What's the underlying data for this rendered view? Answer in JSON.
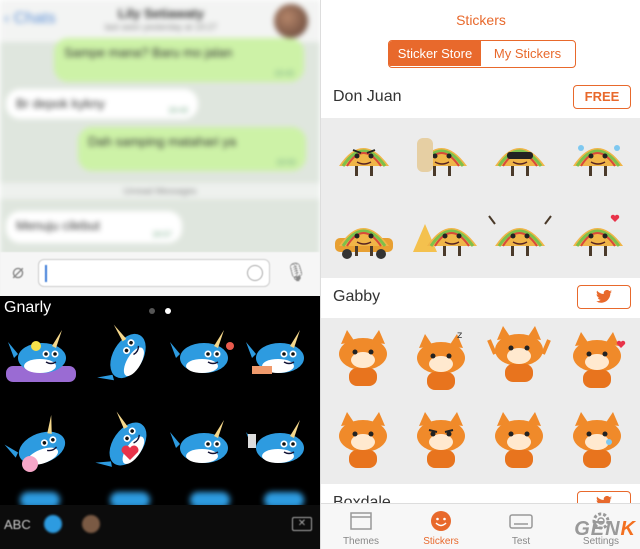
{
  "chat": {
    "back_label": "Chats",
    "name": "Lily Setiawaty",
    "status": "last seen yesterday at 19:27",
    "unread_label": "Unread Messages",
    "messages": [
      {
        "dir": "out",
        "text": "Sampe mana? Baru mo jalan",
        "time": "19:43"
      },
      {
        "dir": "in",
        "text": "Br depok kykny",
        "time": "19:43"
      },
      {
        "dir": "out",
        "text": "Dah samping matahari ya",
        "time": "19:50"
      },
      {
        "dir": "in",
        "text": "Menuju cilebut",
        "time": "19:57"
      }
    ]
  },
  "keyboard": {
    "pack_title": "Gnarly",
    "abc_label": "ABC",
    "delete_icon": "backspace-icon"
  },
  "store": {
    "title": "Stickers",
    "segments": [
      "Sticker Store",
      "My Stickers"
    ],
    "packs": [
      {
        "name": "Don Juan",
        "button": "FREE",
        "theme": "taco"
      },
      {
        "name": "Gabby",
        "button": "",
        "button_icon": "twitter-bird-icon",
        "theme": "cat"
      },
      {
        "name": "Boxdale",
        "button": "",
        "button_icon": "twitter-bird-icon",
        "theme": "none"
      }
    ],
    "tabs": [
      {
        "label": "Themes",
        "icon": "themes-icon"
      },
      {
        "label": "Stickers",
        "icon": "smiley-icon",
        "active": true
      },
      {
        "label": "Test",
        "icon": "keyboard-icon"
      },
      {
        "label": "Settings",
        "icon": "gear-icon"
      }
    ]
  },
  "watermark": {
    "text_a": "GEN",
    "text_b": "K"
  },
  "colors": {
    "accent": "#e8692c",
    "bubble_out": "#cdf2a7",
    "keyboard_bg": "#000000",
    "narwhal": "#2d9be0"
  }
}
